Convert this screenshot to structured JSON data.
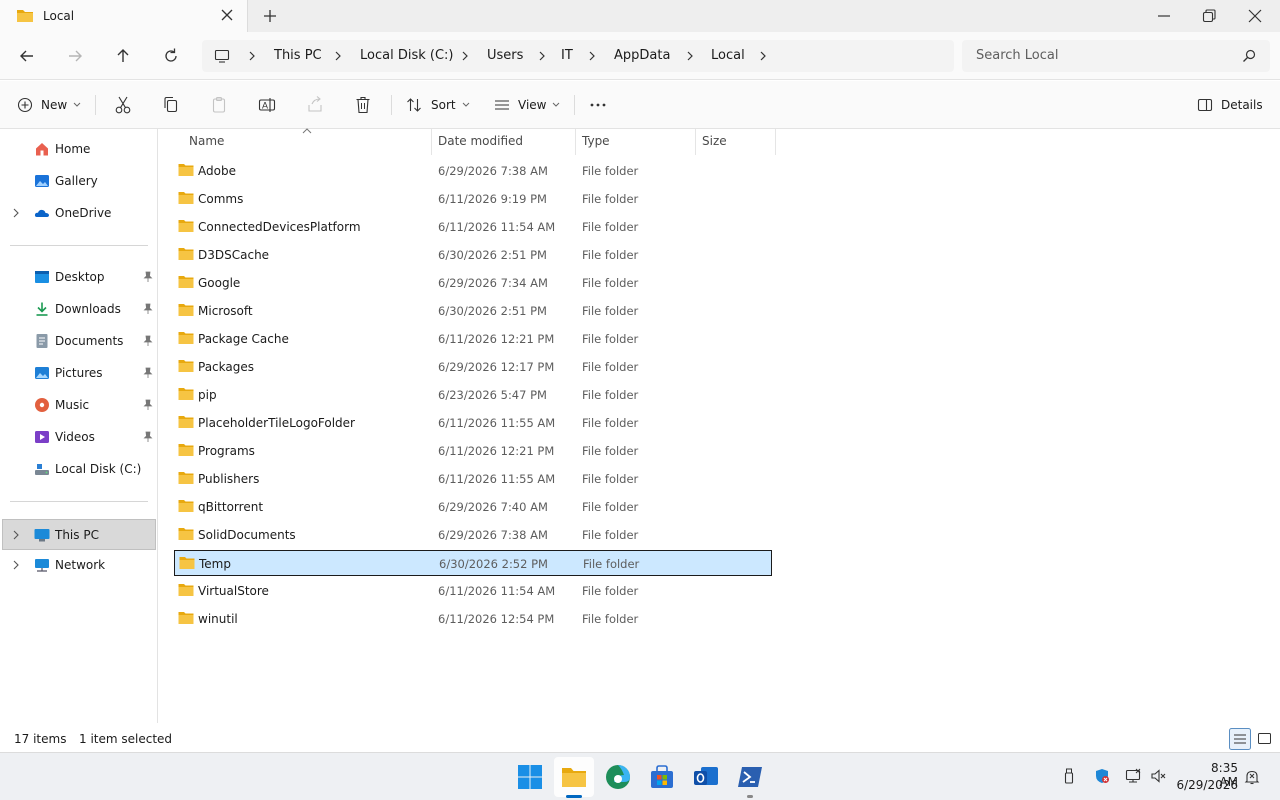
{
  "window": {
    "tab_title": "Local"
  },
  "address": {
    "crumbs": [
      "This PC",
      "Local Disk (C:)",
      "Users",
      "IT",
      "AppData",
      "Local"
    ],
    "search_placeholder": "Search Local"
  },
  "toolbar": {
    "new_label": "New",
    "sort_label": "Sort",
    "view_label": "View",
    "details_label": "Details"
  },
  "sidebar": {
    "home": "Home",
    "gallery": "Gallery",
    "onedrive": "OneDrive",
    "desktop": "Desktop",
    "downloads": "Downloads",
    "documents": "Documents",
    "pictures": "Pictures",
    "music": "Music",
    "videos": "Videos",
    "local_disk": "Local Disk (C:)",
    "this_pc": "This PC",
    "network": "Network"
  },
  "columns": {
    "name": "Name",
    "date": "Date modified",
    "type": "Type",
    "size": "Size"
  },
  "files": [
    {
      "name": "Adobe",
      "date": "6/29/2026 7:38 AM",
      "type": "File folder"
    },
    {
      "name": "Comms",
      "date": "6/11/2026 9:19 PM",
      "type": "File folder"
    },
    {
      "name": "ConnectedDevicesPlatform",
      "date": "6/11/2026 11:54 AM",
      "type": "File folder"
    },
    {
      "name": "D3DSCache",
      "date": "6/30/2026 2:51 PM",
      "type": "File folder"
    },
    {
      "name": "Google",
      "date": "6/29/2026 7:34 AM",
      "type": "File folder"
    },
    {
      "name": "Microsoft",
      "date": "6/30/2026 2:51 PM",
      "type": "File folder"
    },
    {
      "name": "Package Cache",
      "date": "6/11/2026 12:21 PM",
      "type": "File folder"
    },
    {
      "name": "Packages",
      "date": "6/29/2026 12:17 PM",
      "type": "File folder"
    },
    {
      "name": "pip",
      "date": "6/23/2026 5:47 PM",
      "type": "File folder"
    },
    {
      "name": "PlaceholderTileLogoFolder",
      "date": "6/11/2026 11:55 AM",
      "type": "File folder"
    },
    {
      "name": "Programs",
      "date": "6/11/2026 12:21 PM",
      "type": "File folder"
    },
    {
      "name": "Publishers",
      "date": "6/11/2026 11:55 AM",
      "type": "File folder"
    },
    {
      "name": "qBittorrent",
      "date": "6/29/2026 7:40 AM",
      "type": "File folder"
    },
    {
      "name": "SolidDocuments",
      "date": "6/29/2026 7:38 AM",
      "type": "File folder"
    },
    {
      "name": "Temp",
      "date": "6/30/2026 2:52 PM",
      "type": "File folder"
    },
    {
      "name": "VirtualStore",
      "date": "6/11/2026 11:54 AM",
      "type": "File folder"
    },
    {
      "name": "winutil",
      "date": "6/11/2026 12:54 PM",
      "type": "File folder"
    }
  ],
  "selected_file": "Temp",
  "status": {
    "count": "17 items",
    "selection": "1 item selected"
  },
  "clock": {
    "time": "8:35 AM",
    "date": "6/29/2026"
  },
  "colors": {
    "accent": "#0067c0",
    "folder": "#f6c443",
    "selection": "#cce8ff"
  }
}
